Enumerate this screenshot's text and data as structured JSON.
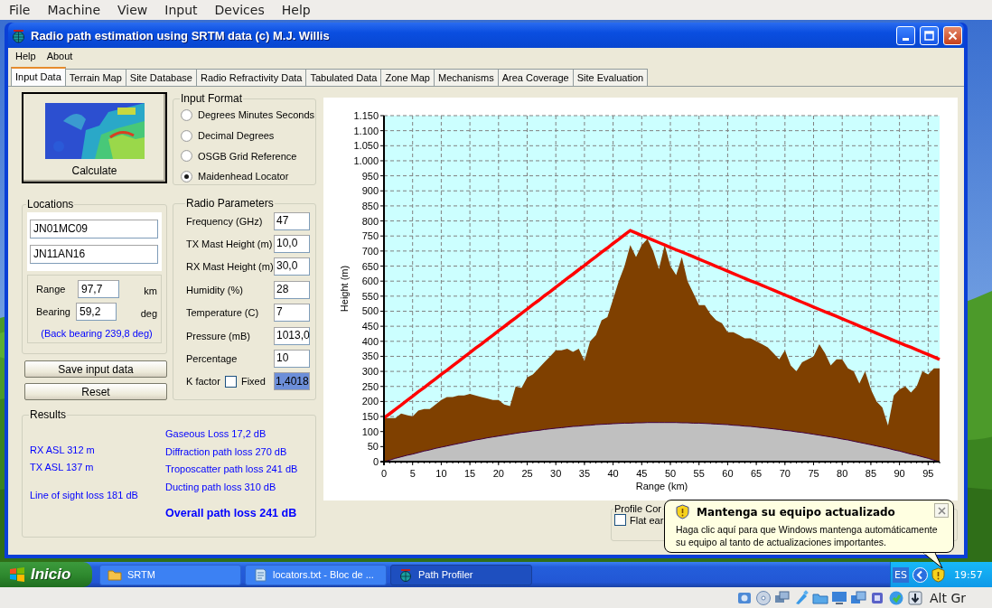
{
  "host_menu": [
    "File",
    "Machine",
    "View",
    "Input",
    "Devices",
    "Help"
  ],
  "window": {
    "title": "Radio path estimation using SRTM data (c) M.J. Willis",
    "menu": [
      "Help",
      "About"
    ],
    "tabs": [
      {
        "label": "Input Data",
        "selected": true
      },
      {
        "label": "Terrain Map",
        "selected": false
      },
      {
        "label": "Site Database",
        "selected": false
      },
      {
        "label": "Radio Refractivity Data",
        "selected": false
      },
      {
        "label": "Tabulated Data",
        "selected": false
      },
      {
        "label": "Zone Map",
        "selected": false
      },
      {
        "label": "Mechanisms",
        "selected": false
      },
      {
        "label": "Area Coverage",
        "selected": false
      },
      {
        "label": "Site Evaluation",
        "selected": false
      }
    ],
    "calculate_button": {
      "label": "Calculate"
    },
    "input_format": {
      "title": "Input Format",
      "options": [
        {
          "label": "Degrees Minutes Seconds",
          "selected": false
        },
        {
          "label": "Decimal Degrees",
          "selected": false
        },
        {
          "label": "OSGB Grid Reference",
          "selected": false
        },
        {
          "label": "Maidenhead Locator",
          "selected": true
        }
      ]
    },
    "locations": {
      "title": "Locations",
      "fields": [
        "JN01MC09",
        "JN11AN16"
      ],
      "range": {
        "label": "Range",
        "value": "97,7",
        "unit": "km"
      },
      "bearing": {
        "label": "Bearing",
        "value": "59,2",
        "unit": "deg"
      },
      "back_bearing": "(Back bearing 239,8 deg)"
    },
    "radio_parameters": {
      "title": "Radio Parameters",
      "fields": [
        {
          "label": "Frequency (GHz)",
          "value": "47"
        },
        {
          "label": "TX Mast Height (m)",
          "value": "10,0"
        },
        {
          "label": "RX Mast Height (m)",
          "value": "30,0"
        },
        {
          "label": "Humidity (%)",
          "value": "28"
        },
        {
          "label": "Temperature (C)",
          "value": "7"
        },
        {
          "label": "Pressure (mB)",
          "value": "1013,0"
        },
        {
          "label": "Percentage",
          "value": "10"
        }
      ],
      "k_factor": {
        "label": "K factor",
        "fixed_label": "Fixed",
        "fixed_checked": false,
        "value": "1,4018",
        "selected": true
      }
    },
    "buttons": [
      "Save input data",
      "Reset"
    ],
    "results": {
      "title": "Results",
      "left": [
        "RX ASL 312 m",
        "TX ASL 137 m",
        "Line of sight loss 181 dB"
      ],
      "right": [
        "Gaseous Loss 17,2 dB",
        "Diffraction path loss 270 dB",
        "Troposcatter path loss 241 dB",
        "Ducting path loss 310 dB"
      ],
      "overall": "Overall path loss 241 dB"
    },
    "chart": {
      "chart_data": {
        "type": "area",
        "grid": true,
        "xlabel": "Range (km)",
        "ylabel": "Height (m)",
        "xlim": [
          0,
          97
        ],
        "ylim": [
          0,
          1150
        ],
        "xticks": [
          0,
          5,
          10,
          15,
          20,
          25,
          30,
          35,
          40,
          45,
          50,
          55,
          60,
          65,
          70,
          75,
          80,
          85,
          90,
          95
        ],
        "yticks": [
          0,
          50,
          100,
          150,
          200,
          250,
          300,
          350,
          400,
          450,
          500,
          550,
          600,
          650,
          700,
          750,
          800,
          850,
          900,
          950,
          {
            "value": 1000,
            "label": "1.000"
          },
          {
            "value": 1050,
            "label": "1.050"
          },
          {
            "value": 1100,
            "label": "1.100"
          },
          {
            "value": 1150,
            "label": "1.150"
          }
        ],
        "x": [
          0,
          1,
          2,
          3,
          4,
          5,
          6,
          7,
          8,
          9,
          10,
          11,
          12,
          13,
          14,
          15,
          16,
          17,
          18,
          19,
          20,
          21,
          22,
          23,
          24,
          25,
          26,
          27,
          28,
          29,
          30,
          31,
          32,
          33,
          34,
          35,
          36,
          37,
          38,
          39,
          40,
          41,
          42,
          43,
          44,
          45,
          46,
          47,
          48,
          49,
          50,
          51,
          52,
          53,
          54,
          55,
          56,
          57,
          58,
          59,
          60,
          61,
          62,
          63,
          64,
          65,
          66,
          67,
          68,
          69,
          70,
          71,
          72,
          73,
          74,
          75,
          76,
          77,
          78,
          79,
          80,
          81,
          82,
          83,
          84,
          85,
          86,
          87,
          88,
          89,
          90,
          91,
          92,
          93,
          94,
          95,
          96,
          97
        ],
        "series": [
          {
            "type": "area",
            "color": "#7f4000",
            "values": [
              145,
              145,
              145,
              160,
              155,
              150,
              170,
              175,
              175,
              190,
              205,
              215,
              215,
              220,
              220,
              225,
              220,
              215,
              210,
              205,
              205,
              190,
              185,
              250,
              245,
              280,
              290,
              310,
              330,
              350,
              370,
              370,
              375,
              365,
              375,
              335,
              400,
              420,
              470,
              480,
              540,
              600,
              650,
              720,
              680,
              720,
              740,
              700,
              640,
              720,
              650,
              620,
              680,
              600,
              560,
              520,
              520,
              490,
              470,
              460,
              430,
              430,
              420,
              410,
              410,
              400,
              390,
              380,
              360,
              340,
              370,
              320,
              300,
              330,
              340,
              350,
              390,
              360,
              320,
              340,
              340,
              310,
              300,
              260,
              300,
              240,
              200,
              180,
              120,
              220,
              240,
              250,
              230,
              250,
              300,
              290,
              310,
              310
            ]
          },
          {
            "type": "area",
            "color": "#c0c0c0",
            "values": [
              0,
              5,
              11,
              16,
              21,
              25,
              30,
              35,
              39,
              44,
              48,
              52,
              56,
              60,
              64,
              68,
              72,
              75,
              79,
              82,
              85,
              88,
              91,
              94,
              97,
              99,
              102,
              104,
              107,
              109,
              111,
              113,
              115,
              117,
              118,
              120,
              121,
              123,
              124,
              125,
              126,
              127,
              128,
              128,
              129,
              129,
              130,
              130,
              130,
              130,
              130,
              130,
              129,
              129,
              128,
              128,
              127,
              126,
              125,
              124,
              123,
              121,
              120,
              118,
              117,
              115,
              113,
              111,
              109,
              107,
              104,
              102,
              99,
              97,
              94,
              91,
              88,
              85,
              82,
              79,
              75,
              72,
              68,
              64,
              60,
              56,
              52,
              48,
              44,
              39,
              35,
              30,
              25,
              21,
              16,
              11,
              5,
              0
            ]
          },
          {
            "type": "line",
            "color": "#ff0000",
            "values": [
              145,
              159,
              174,
              188,
              203,
              217,
              232,
              246,
              261,
              275,
              290,
              304,
              319,
              333,
              348,
              362,
              377,
              391,
              406,
              420,
              435,
              449,
              464,
              478,
              493,
              507,
              522,
              536,
              551,
              565,
              580,
              594,
              609,
              623,
              638,
              652,
              667,
              681,
              696,
              710,
              725,
              739,
              754,
              768,
              760,
              752,
              744,
              736,
              728,
              720,
              712,
              704,
              697,
              689,
              681,
              673,
              665,
              657,
              649,
              641,
              633,
              625,
              617,
              609,
              601,
              594,
              586,
              578,
              570,
              562,
              554,
              546,
              538,
              530,
              522,
              514,
              506,
              498,
              491,
              483,
              475,
              467,
              459,
              451,
              443,
              435,
              427,
              419,
              411,
              403,
              395,
              387,
              380,
              372,
              364,
              356,
              348,
              340
            ]
          }
        ]
      }
    },
    "profile_controls": {
      "title": "Profile Cor",
      "flat_earth": {
        "label": "Flat ear",
        "checked": false
      }
    }
  },
  "balloon": {
    "title": "Mantenga su equipo actualizado",
    "text": "Haga clic aquí para que Windows mantenga automáticamente su equipo al tanto de actualizaciones importantes."
  },
  "taskbar": {
    "start": "Inicio",
    "tasks": [
      {
        "kind": "folder",
        "label": "SRTM",
        "selected": false
      },
      {
        "kind": "notepad",
        "label": "locators.txt - Bloc de ...",
        "selected": false
      },
      {
        "kind": "globe",
        "label": "Path Profiler",
        "selected": true
      }
    ],
    "language": "ES",
    "clock": "19:57"
  },
  "host_status": {
    "keyboard": "Alt Gr"
  }
}
